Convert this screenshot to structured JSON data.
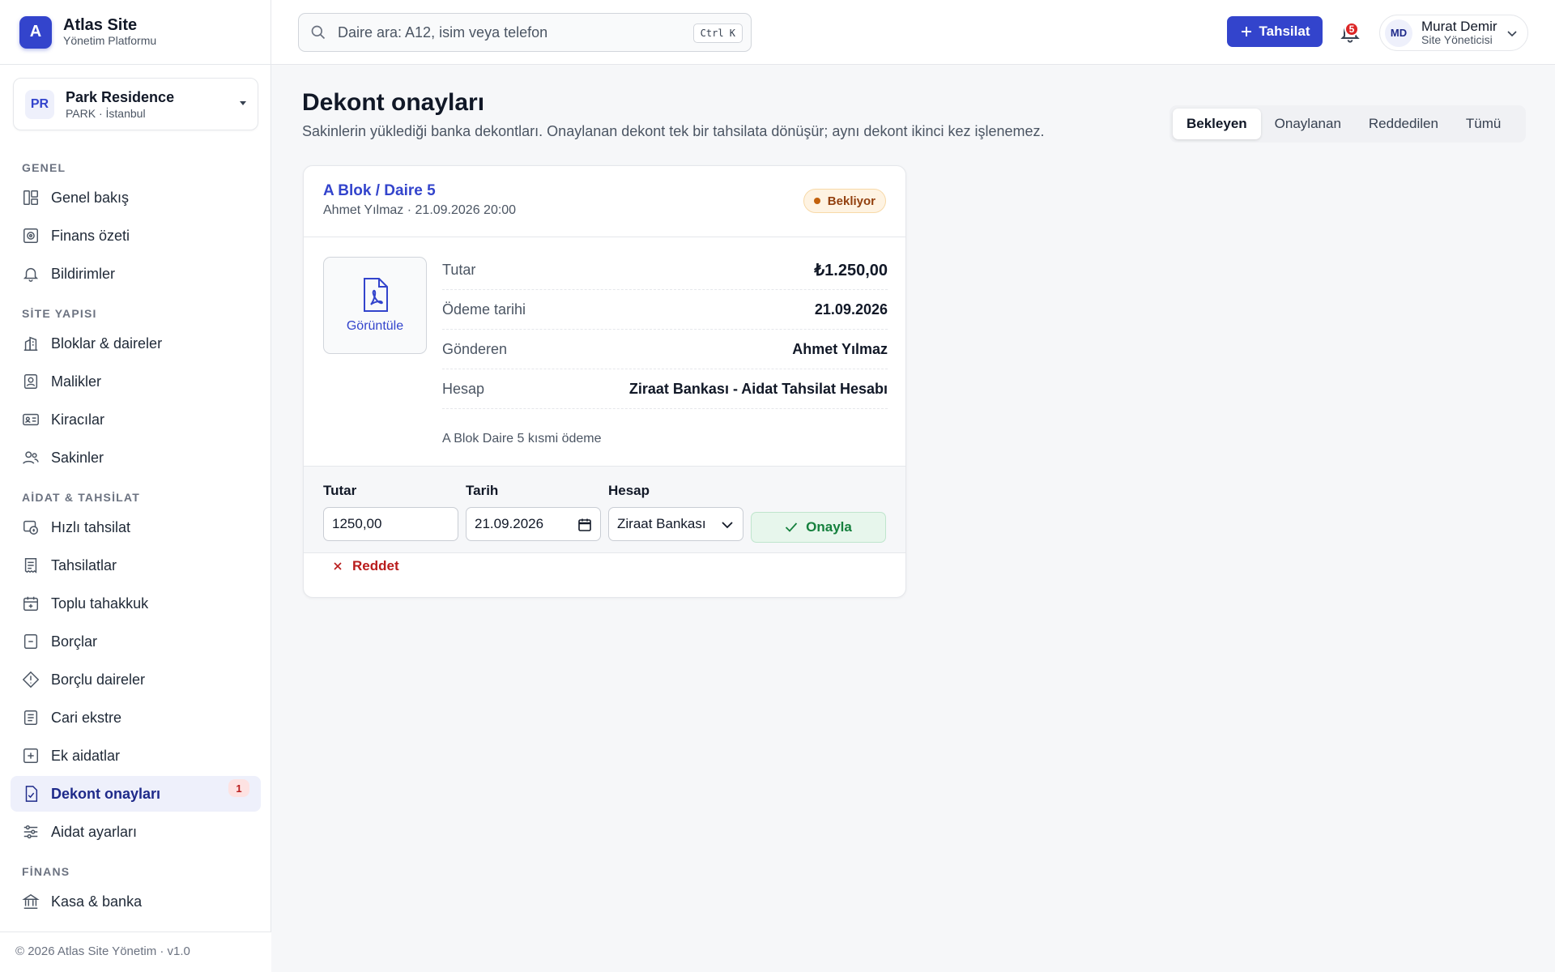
{
  "brand": {
    "logo_letter": "A",
    "name": "Atlas Site",
    "subtitle": "Yönetim Platformu"
  },
  "site": {
    "initials": "PR",
    "name": "Park Residence",
    "sub": "PARK · İstanbul"
  },
  "nav": {
    "sections": [
      {
        "title": "GENEL",
        "items": [
          {
            "label": "Genel bakış",
            "icon": "dashboard-icon"
          },
          {
            "label": "Finans özeti",
            "icon": "finance-summary-icon"
          },
          {
            "label": "Bildirimler",
            "icon": "bell-icon"
          }
        ]
      },
      {
        "title": "SİTE YAPISI",
        "items": [
          {
            "label": "Bloklar & daireler",
            "icon": "building-icon"
          },
          {
            "label": "Malikler",
            "icon": "owner-icon"
          },
          {
            "label": "Kiracılar",
            "icon": "id-card-icon"
          },
          {
            "label": "Sakinler",
            "icon": "users-icon"
          }
        ]
      },
      {
        "title": "AİDAT & TAHSİLAT",
        "items": [
          {
            "label": "Hızlı tahsilat",
            "icon": "quick-payment-icon"
          },
          {
            "label": "Tahsilatlar",
            "icon": "receipt-icon"
          },
          {
            "label": "Toplu tahakkuk",
            "icon": "calendar-plus-icon"
          },
          {
            "label": "Borçlar",
            "icon": "debt-icon"
          },
          {
            "label": "Borçlu daireler",
            "icon": "warning-diamond-icon"
          },
          {
            "label": "Cari ekstre",
            "icon": "statement-icon"
          },
          {
            "label": "Ek aidatlar",
            "icon": "plus-square-icon"
          },
          {
            "label": "Dekont onayları",
            "icon": "file-check-icon",
            "active": true,
            "badge": "1"
          },
          {
            "label": "Aidat ayarları",
            "icon": "sliders-icon"
          }
        ]
      },
      {
        "title": "FİNANS",
        "items": [
          {
            "label": "Kasa & banka",
            "icon": "bank-icon"
          }
        ]
      }
    ]
  },
  "footer": "© 2026 Atlas Site Yönetim · v1.0",
  "topbar": {
    "search_placeholder": "Daire ara: A12, isim veya telefon",
    "shortcut": "Ctrl K",
    "primary_button": "Tahsilat",
    "notification_count": "5",
    "user": {
      "initials": "MD",
      "name": "Murat Demir",
      "role": "Site Yöneticisi"
    }
  },
  "page": {
    "title": "Dekont onayları",
    "subtitle": "Sakinlerin yüklediği banka dekontları. Onaylanan dekont tek bir tahsilata dönüşür; aynı dekont ikinci kez işlenemez.",
    "tabs": [
      {
        "label": "Bekleyen",
        "active": true
      },
      {
        "label": "Onaylanan"
      },
      {
        "label": "Reddedilen"
      },
      {
        "label": "Tümü"
      }
    ]
  },
  "receipt": {
    "unit": "A Blok / Daire 5",
    "meta": "Ahmet Yılmaz · 21.09.2026 20:00",
    "status": "Bekliyor",
    "preview_label": "Görüntüle",
    "details": [
      {
        "label": "Tutar",
        "value": "₺1.250,00"
      },
      {
        "label": "Ödeme tarihi",
        "value": "21.09.2026"
      },
      {
        "label": "Gönderen",
        "value": "Ahmet Yılmaz"
      },
      {
        "label": "Hesap",
        "value": "Ziraat Bankası - Aidat Tahsilat Hesabı"
      }
    ],
    "note": "A Blok Daire 5 kısmi ödeme",
    "form": {
      "amount_label": "Tutar",
      "amount_value": "1250,00",
      "date_label": "Tarih",
      "date_value": "21.09.2026",
      "account_label": "Hesap",
      "account_value": "Ziraat Bankası",
      "approve_label": "Onayla",
      "reject_label": "Reddet"
    }
  },
  "colors": {
    "accent": "#3344cc",
    "success": "#15803d",
    "danger": "#b91c1c",
    "warning": "#92400e"
  }
}
